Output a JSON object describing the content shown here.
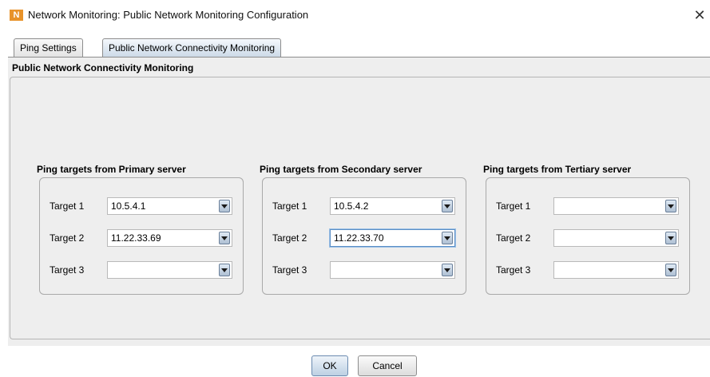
{
  "window": {
    "app_icon_text": "N",
    "title": "Network Monitoring: Public Network Monitoring Configuration",
    "close_glyph": "✕",
    "app_icon_color": "#e8932a"
  },
  "tabs": [
    {
      "label": "Ping Settings",
      "selected": false
    },
    {
      "label": "Public Network Connectivity Monitoring",
      "selected": true
    }
  ],
  "panel": {
    "heading": "Public Network Connectivity Monitoring"
  },
  "groups": [
    {
      "title": "Ping targets from Primary server",
      "rows": [
        {
          "label": "Target 1",
          "value": "10.5.4.1"
        },
        {
          "label": "Target 2",
          "value": "11.22.33.69"
        },
        {
          "label": "Target 3",
          "value": ""
        }
      ]
    },
    {
      "title": "Ping targets from Secondary server",
      "rows": [
        {
          "label": "Target 1",
          "value": "10.5.4.2"
        },
        {
          "label": "Target 2",
          "value": "11.22.33.70"
        },
        {
          "label": "Target 3",
          "value": ""
        }
      ]
    },
    {
      "title": "Ping targets from Tertiary server",
      "rows": [
        {
          "label": "Target 1",
          "value": ""
        },
        {
          "label": "Target 2",
          "value": ""
        },
        {
          "label": "Target 3",
          "value": ""
        }
      ]
    }
  ],
  "buttons": {
    "ok": "OK",
    "cancel": "Cancel"
  },
  "icons": {
    "dropdown": "chevron-down-icon",
    "close": "close-icon",
    "app": "app-logo-icon"
  }
}
